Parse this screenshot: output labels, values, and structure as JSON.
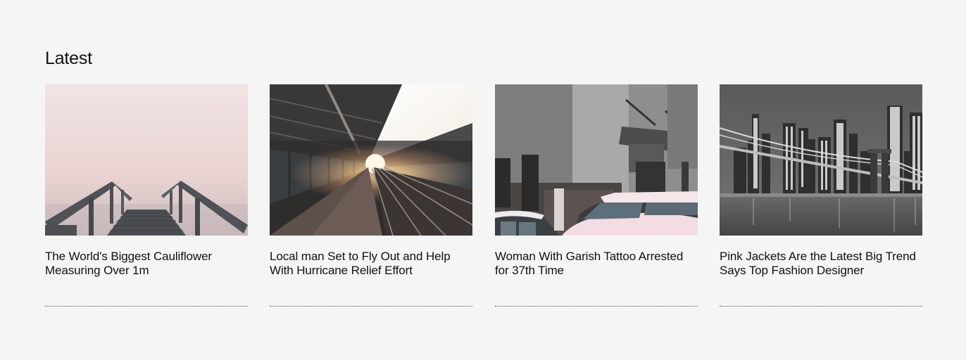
{
  "section": {
    "title": "Latest"
  },
  "articles": [
    {
      "title": "The World's Biggest Cauliflower Measuring Over 1m",
      "image_subject": "foggy-pier-staircase-image"
    },
    {
      "title": "Local man Set to Fly Out and Help With Hurricane Relief Effort",
      "image_subject": "train-station-platform-image"
    },
    {
      "title": "Woman With Garish Tattoo Arrested for 37th Time",
      "image_subject": "snowy-car-building-image"
    },
    {
      "title": "Pink Jackets Are the Latest Big Trend Says Top Fashion Designer",
      "image_subject": "city-bridge-night-image"
    }
  ],
  "colors": {
    "background": "#f5f5f5",
    "text": "#111111",
    "rule": "#555555"
  }
}
